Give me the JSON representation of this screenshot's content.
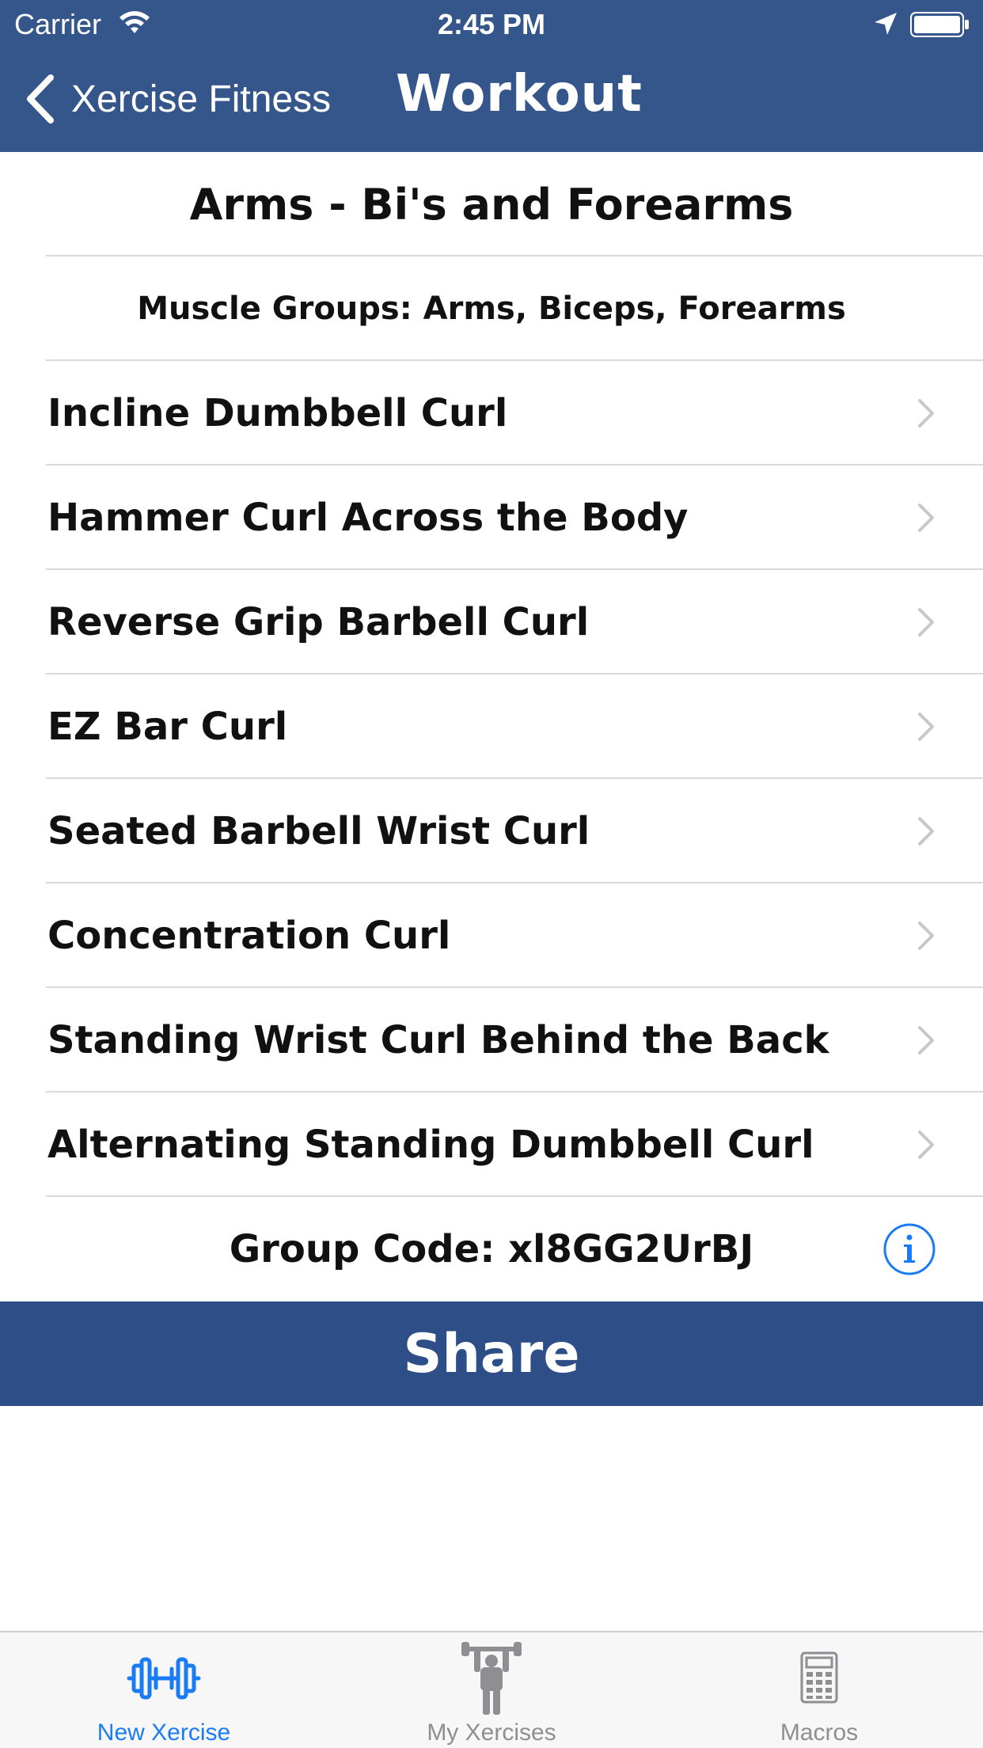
{
  "status_bar": {
    "carrier": "Carrier",
    "time": "2:45 PM"
  },
  "nav": {
    "back_label": "Xercise Fitness",
    "title": "Workout"
  },
  "workout": {
    "title": "Arms - Bi's and Forearms",
    "muscle_groups": "Muscle Groups: Arms, Biceps, Forearms",
    "exercises": [
      "Incline Dumbbell Curl",
      "Hammer Curl Across the Body",
      "Reverse Grip Barbell Curl",
      "EZ Bar Curl",
      "Seated Barbell Wrist Curl",
      "Concentration Curl",
      "Standing Wrist Curl Behind the Back",
      "Alternating Standing Dumbbell Curl"
    ],
    "group_code": "Group Code: xl8GG2UrBJ"
  },
  "share_label": "Share",
  "tabs": [
    {
      "label": "New Xercise",
      "icon": "dumbbell-icon",
      "active": true
    },
    {
      "label": "My Xercises",
      "icon": "weightlifter-icon",
      "active": false
    },
    {
      "label": "Macros",
      "icon": "calculator-icon",
      "active": false
    }
  ],
  "colors": {
    "header_bg": "#34568b",
    "share_bg": "#2d4e86",
    "tab_active": "#1a7cf5",
    "tab_inactive": "#8e8e93",
    "info_blue": "#1a7cf5"
  }
}
